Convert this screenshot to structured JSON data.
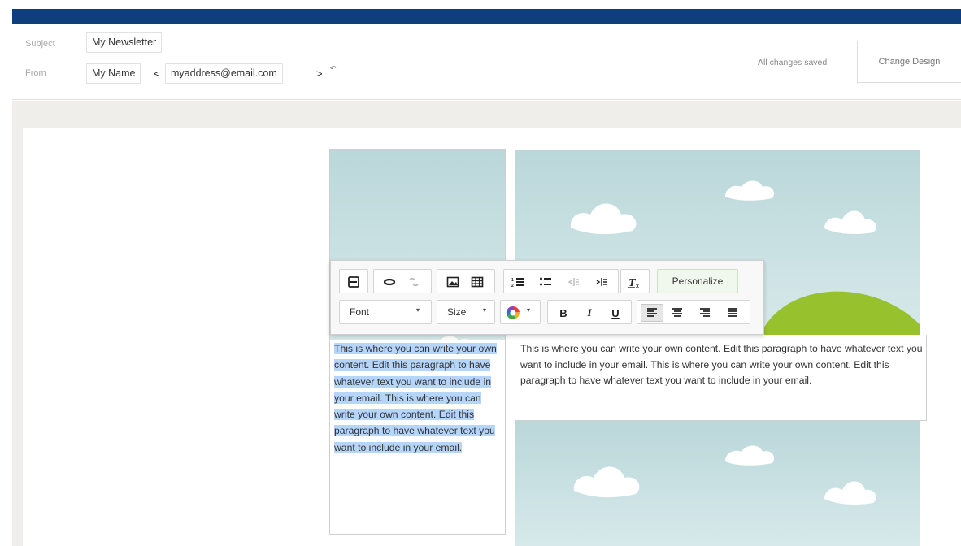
{
  "header": {
    "subject_label": "Subject",
    "subject_value": "My Newsletter",
    "from_label": "From",
    "from_name": "My Name",
    "open_bracket": "<",
    "from_email": "myaddress@email.com",
    "close_bracket": ">",
    "status": "All changes saved",
    "change_design_label": "Change Design"
  },
  "toolbar": {
    "font_label": "Font",
    "size_label": "Size",
    "bold": "B",
    "italic": "I",
    "underline": "U",
    "personalize_label": "Personalize",
    "icons": [
      "save-icon",
      "link-icon",
      "unlink-icon",
      "image-icon",
      "table-icon",
      "numbered-list-icon",
      "bulleted-list-icon",
      "outdent-icon",
      "indent-icon",
      "clear-format-icon",
      "text-color-icon",
      "align-left-icon",
      "align-center-icon",
      "align-right-icon",
      "justify-icon"
    ]
  },
  "content": {
    "left_paragraph": "This is where you can write your own content. Edit this paragraph to have whatever text you want to include in your email. This is where you can write your own content. Edit this paragraph to have whatever text you want to include in your email.",
    "right_paragraph": "This is where you can write your own content. Edit this paragraph to have whatever text you want to include in your email. This is where you can write your own content. Edit this paragraph to have whatever text you want to include in your email."
  },
  "colors": {
    "top_bar": "#0f3e7c",
    "selection": "#b5d5fb",
    "sky": "#c8e0e2",
    "hill": "#97c22e"
  }
}
